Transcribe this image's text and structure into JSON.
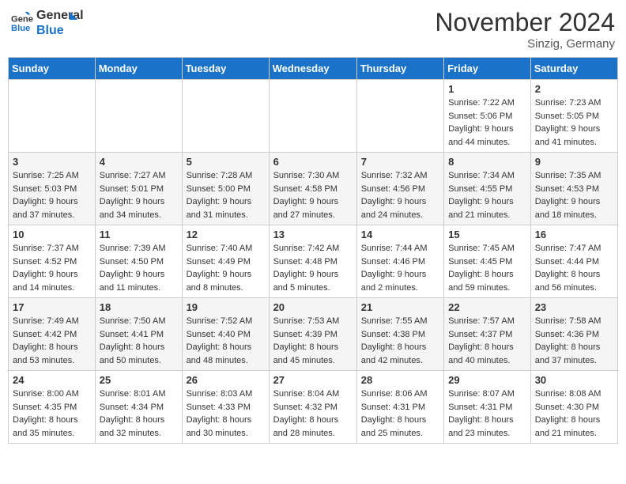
{
  "header": {
    "logo_line1": "General",
    "logo_line2": "Blue",
    "month": "November 2024",
    "location": "Sinzig, Germany"
  },
  "weekdays": [
    "Sunday",
    "Monday",
    "Tuesday",
    "Wednesday",
    "Thursday",
    "Friday",
    "Saturday"
  ],
  "weeks": [
    [
      {
        "day": "",
        "info": ""
      },
      {
        "day": "",
        "info": ""
      },
      {
        "day": "",
        "info": ""
      },
      {
        "day": "",
        "info": ""
      },
      {
        "day": "",
        "info": ""
      },
      {
        "day": "1",
        "info": "Sunrise: 7:22 AM\nSunset: 5:06 PM\nDaylight: 9 hours and 44 minutes."
      },
      {
        "day": "2",
        "info": "Sunrise: 7:23 AM\nSunset: 5:05 PM\nDaylight: 9 hours and 41 minutes."
      }
    ],
    [
      {
        "day": "3",
        "info": "Sunrise: 7:25 AM\nSunset: 5:03 PM\nDaylight: 9 hours and 37 minutes."
      },
      {
        "day": "4",
        "info": "Sunrise: 7:27 AM\nSunset: 5:01 PM\nDaylight: 9 hours and 34 minutes."
      },
      {
        "day": "5",
        "info": "Sunrise: 7:28 AM\nSunset: 5:00 PM\nDaylight: 9 hours and 31 minutes."
      },
      {
        "day": "6",
        "info": "Sunrise: 7:30 AM\nSunset: 4:58 PM\nDaylight: 9 hours and 27 minutes."
      },
      {
        "day": "7",
        "info": "Sunrise: 7:32 AM\nSunset: 4:56 PM\nDaylight: 9 hours and 24 minutes."
      },
      {
        "day": "8",
        "info": "Sunrise: 7:34 AM\nSunset: 4:55 PM\nDaylight: 9 hours and 21 minutes."
      },
      {
        "day": "9",
        "info": "Sunrise: 7:35 AM\nSunset: 4:53 PM\nDaylight: 9 hours and 18 minutes."
      }
    ],
    [
      {
        "day": "10",
        "info": "Sunrise: 7:37 AM\nSunset: 4:52 PM\nDaylight: 9 hours and 14 minutes."
      },
      {
        "day": "11",
        "info": "Sunrise: 7:39 AM\nSunset: 4:50 PM\nDaylight: 9 hours and 11 minutes."
      },
      {
        "day": "12",
        "info": "Sunrise: 7:40 AM\nSunset: 4:49 PM\nDaylight: 9 hours and 8 minutes."
      },
      {
        "day": "13",
        "info": "Sunrise: 7:42 AM\nSunset: 4:48 PM\nDaylight: 9 hours and 5 minutes."
      },
      {
        "day": "14",
        "info": "Sunrise: 7:44 AM\nSunset: 4:46 PM\nDaylight: 9 hours and 2 minutes."
      },
      {
        "day": "15",
        "info": "Sunrise: 7:45 AM\nSunset: 4:45 PM\nDaylight: 8 hours and 59 minutes."
      },
      {
        "day": "16",
        "info": "Sunrise: 7:47 AM\nSunset: 4:44 PM\nDaylight: 8 hours and 56 minutes."
      }
    ],
    [
      {
        "day": "17",
        "info": "Sunrise: 7:49 AM\nSunset: 4:42 PM\nDaylight: 8 hours and 53 minutes."
      },
      {
        "day": "18",
        "info": "Sunrise: 7:50 AM\nSunset: 4:41 PM\nDaylight: 8 hours and 50 minutes."
      },
      {
        "day": "19",
        "info": "Sunrise: 7:52 AM\nSunset: 4:40 PM\nDaylight: 8 hours and 48 minutes."
      },
      {
        "day": "20",
        "info": "Sunrise: 7:53 AM\nSunset: 4:39 PM\nDaylight: 8 hours and 45 minutes."
      },
      {
        "day": "21",
        "info": "Sunrise: 7:55 AM\nSunset: 4:38 PM\nDaylight: 8 hours and 42 minutes."
      },
      {
        "day": "22",
        "info": "Sunrise: 7:57 AM\nSunset: 4:37 PM\nDaylight: 8 hours and 40 minutes."
      },
      {
        "day": "23",
        "info": "Sunrise: 7:58 AM\nSunset: 4:36 PM\nDaylight: 8 hours and 37 minutes."
      }
    ],
    [
      {
        "day": "24",
        "info": "Sunrise: 8:00 AM\nSunset: 4:35 PM\nDaylight: 8 hours and 35 minutes."
      },
      {
        "day": "25",
        "info": "Sunrise: 8:01 AM\nSunset: 4:34 PM\nDaylight: 8 hours and 32 minutes."
      },
      {
        "day": "26",
        "info": "Sunrise: 8:03 AM\nSunset: 4:33 PM\nDaylight: 8 hours and 30 minutes."
      },
      {
        "day": "27",
        "info": "Sunrise: 8:04 AM\nSunset: 4:32 PM\nDaylight: 8 hours and 28 minutes."
      },
      {
        "day": "28",
        "info": "Sunrise: 8:06 AM\nSunset: 4:31 PM\nDaylight: 8 hours and 25 minutes."
      },
      {
        "day": "29",
        "info": "Sunrise: 8:07 AM\nSunset: 4:31 PM\nDaylight: 8 hours and 23 minutes."
      },
      {
        "day": "30",
        "info": "Sunrise: 8:08 AM\nSunset: 4:30 PM\nDaylight: 8 hours and 21 minutes."
      }
    ]
  ]
}
